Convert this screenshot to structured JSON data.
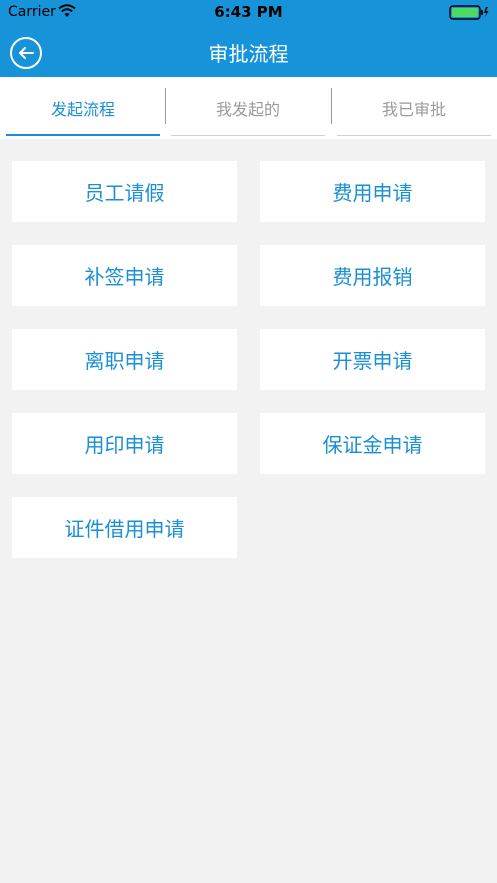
{
  "status_bar": {
    "carrier": "Carrier",
    "time": "6:43 PM"
  },
  "nav": {
    "title": "审批流程",
    "back_icon": "arrow-left-circle-icon"
  },
  "tabs": [
    {
      "label": "发起流程",
      "active": true
    },
    {
      "label": "我发起的",
      "active": false
    },
    {
      "label": "我已审批",
      "active": false
    }
  ],
  "buttons": [
    {
      "label": "员工请假"
    },
    {
      "label": "费用申请"
    },
    {
      "label": "补签申请"
    },
    {
      "label": "费用报销"
    },
    {
      "label": "离职申请"
    },
    {
      "label": "开票申请"
    },
    {
      "label": "用印申请"
    },
    {
      "label": "保证金申请"
    },
    {
      "label": "证件借用申请"
    }
  ],
  "colors": {
    "header": "#1794d9",
    "accent": "#1a8fd2",
    "background": "#f2f2f2",
    "inactive_tab": "#9a9a9a"
  }
}
